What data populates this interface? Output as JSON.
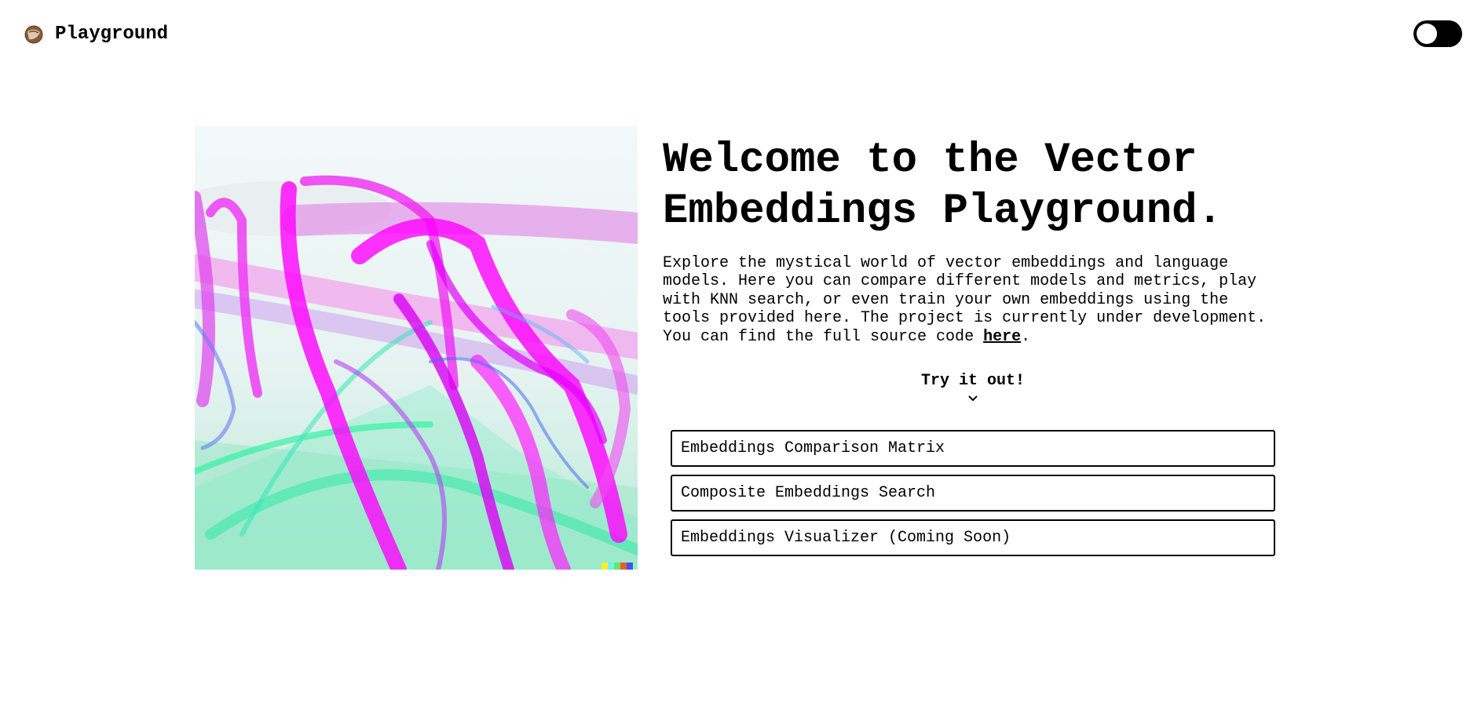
{
  "header": {
    "title": "Playground",
    "logo_icon": "coconut-icon",
    "theme_toggle_icon": "toggle-switch-icon"
  },
  "hero": {
    "title": "Welcome to the Vector Embeddings Playground.",
    "intro_text": "Explore the mystical world of vector embeddings and language models. Here you can compare different models and metrics, play with KNN search, or even train your own embeddings using the tools provided here. The project is currently under development. You can find the full source code ",
    "source_link_label": "here",
    "intro_end": ".",
    "art_icon": "abstract-art-image"
  },
  "cta": {
    "label": "Try it out!",
    "icon": "chevron-down-icon"
  },
  "tools": [
    {
      "label": "Embeddings Comparison Matrix"
    },
    {
      "label": "Composite Embeddings Search"
    },
    {
      "label": "Embeddings Visualizer (Coming Soon)"
    }
  ],
  "colors": {
    "magenta": "#ff00ff",
    "mint": "#2ef0a6",
    "blue": "#4a6cf0",
    "background": "#ffffff",
    "text": "#000000"
  }
}
